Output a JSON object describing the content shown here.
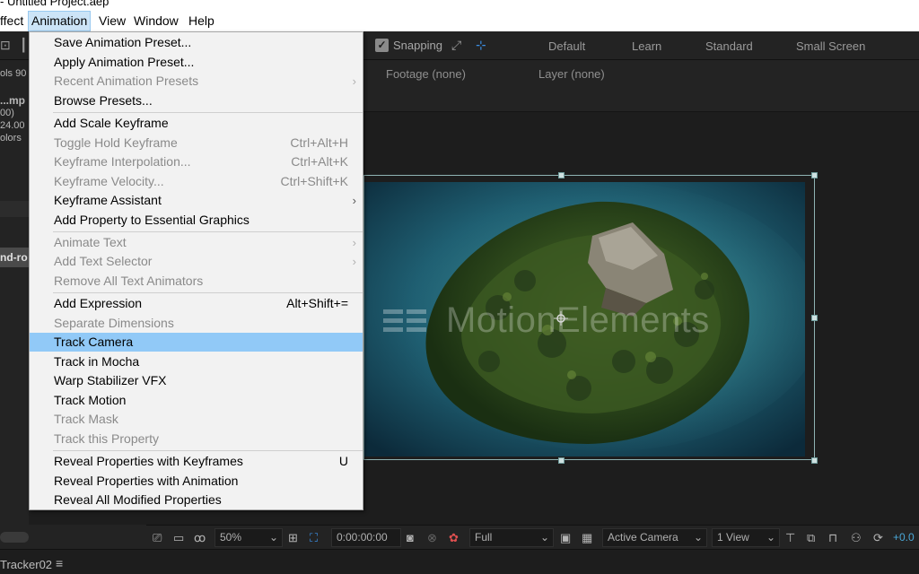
{
  "window": {
    "title": "- Untitled Project.aep"
  },
  "menubar": {
    "items": [
      "ffect",
      "Animation",
      "View",
      "Window",
      "Help"
    ],
    "active": "Animation"
  },
  "toolbar": {
    "snapping_label": "Snapping",
    "snapping_checked": true,
    "workspaces": [
      "Default",
      "Learn",
      "Standard",
      "Small Screen"
    ]
  },
  "left_panel": {
    "fragments": [
      "ols",
      "90",
      "...mp",
      "00)",
      "24.00",
      "olors",
      "nd-ro"
    ]
  },
  "viewer": {
    "footage_label": "Footage",
    "footage_value": "(none)",
    "layer_label": "Layer",
    "layer_value": "(none)",
    "watermark_text": "MotionElements"
  },
  "viewer_bar": {
    "zoom": "50%",
    "timecode": "0:00:00:00",
    "resolution": "Full",
    "camera": "Active Camera",
    "view_layout": "1 View",
    "exposure": "+0.0"
  },
  "timeline": {
    "tab_name": "Tracker02"
  },
  "animation_menu": {
    "items": [
      {
        "label": "Save Animation Preset...",
        "shortcut": "",
        "disabled": false,
        "submenu": false
      },
      {
        "label": "Apply Animation Preset...",
        "shortcut": "",
        "disabled": false,
        "submenu": false
      },
      {
        "label": "Recent Animation Presets",
        "shortcut": "",
        "disabled": true,
        "submenu": true
      },
      {
        "label": "Browse Presets...",
        "shortcut": "",
        "disabled": false,
        "submenu": false
      },
      {
        "label": "Add Scale Keyframe",
        "shortcut": "",
        "disabled": false,
        "submenu": false
      },
      {
        "label": "Toggle Hold Keyframe",
        "shortcut": "Ctrl+Alt+H",
        "disabled": true,
        "submenu": false
      },
      {
        "label": "Keyframe Interpolation...",
        "shortcut": "Ctrl+Alt+K",
        "disabled": true,
        "submenu": false
      },
      {
        "label": "Keyframe Velocity...",
        "shortcut": "Ctrl+Shift+K",
        "disabled": true,
        "submenu": false
      },
      {
        "label": "Keyframe Assistant",
        "shortcut": "",
        "disabled": false,
        "submenu": true
      },
      {
        "label": "Add Property to Essential Graphics",
        "shortcut": "",
        "disabled": false,
        "submenu": false
      },
      {
        "label": "Animate Text",
        "shortcut": "",
        "disabled": true,
        "submenu": true
      },
      {
        "label": "Add Text Selector",
        "shortcut": "",
        "disabled": true,
        "submenu": true
      },
      {
        "label": "Remove All Text Animators",
        "shortcut": "",
        "disabled": true,
        "submenu": false
      },
      {
        "label": "Add Expression",
        "shortcut": "Alt+Shift+=",
        "disabled": false,
        "submenu": false
      },
      {
        "label": "Separate Dimensions",
        "shortcut": "",
        "disabled": true,
        "submenu": false
      },
      {
        "label": "Track Camera",
        "shortcut": "",
        "disabled": false,
        "submenu": false,
        "highlighted": true
      },
      {
        "label": "Track in Mocha",
        "shortcut": "",
        "disabled": false,
        "submenu": false
      },
      {
        "label": "Warp Stabilizer VFX",
        "shortcut": "",
        "disabled": false,
        "submenu": false
      },
      {
        "label": "Track Motion",
        "shortcut": "",
        "disabled": false,
        "submenu": false
      },
      {
        "label": "Track Mask",
        "shortcut": "",
        "disabled": true,
        "submenu": false
      },
      {
        "label": "Track this Property",
        "shortcut": "",
        "disabled": true,
        "submenu": false
      },
      {
        "label": "Reveal Properties with Keyframes",
        "shortcut": "U",
        "disabled": false,
        "submenu": false
      },
      {
        "label": "Reveal Properties with Animation",
        "shortcut": "",
        "disabled": false,
        "submenu": false
      },
      {
        "label": "Reveal All Modified Properties",
        "shortcut": "",
        "disabled": false,
        "submenu": false
      }
    ]
  }
}
